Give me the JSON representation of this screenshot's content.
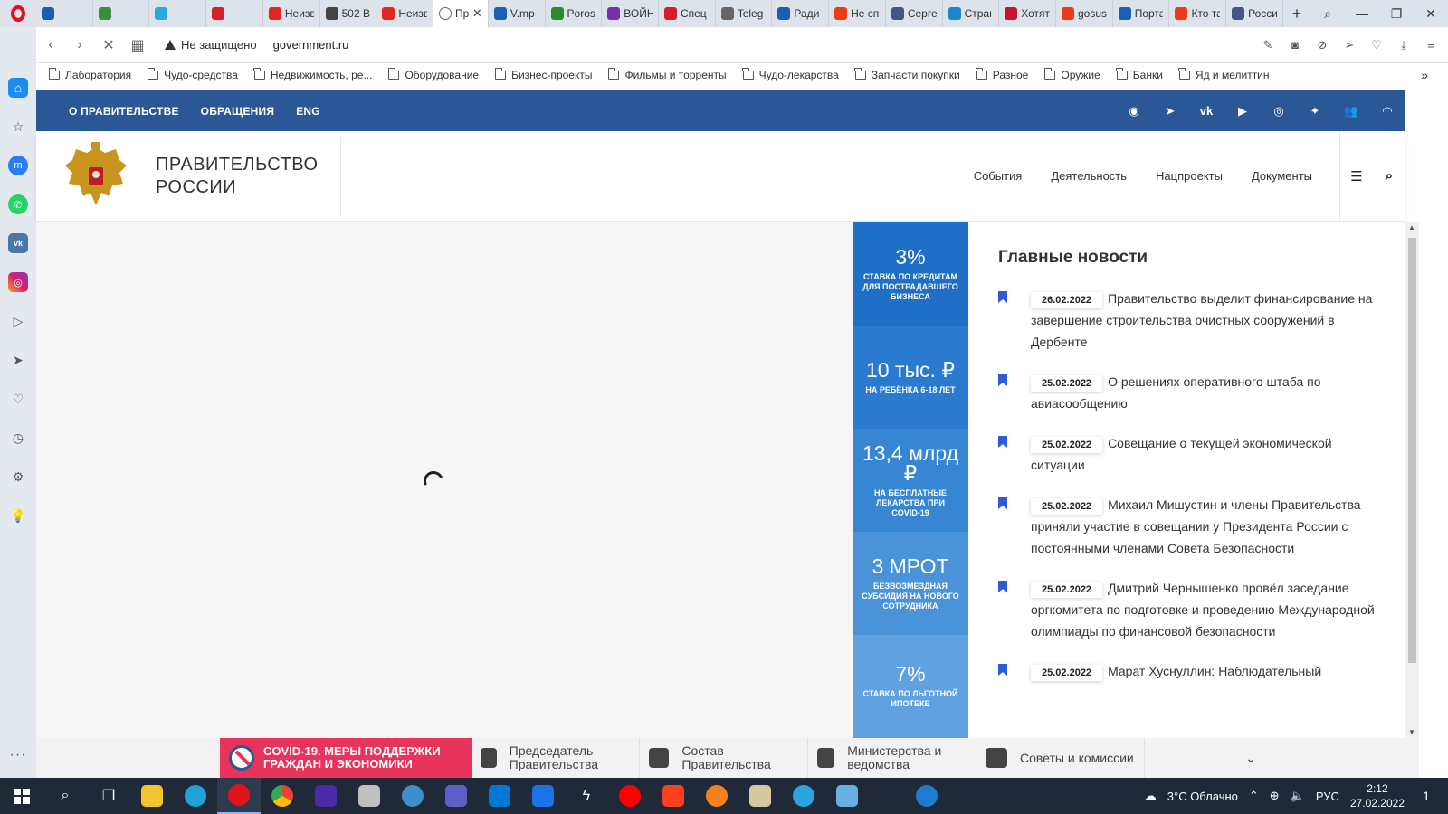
{
  "browser": {
    "tabs": [
      {
        "title": "",
        "color": "#1b5fb5"
      },
      {
        "title": "",
        "color": "#3b8e3b"
      },
      {
        "title": "",
        "color": "#29a9e0"
      },
      {
        "title": "",
        "color": "#d21f2b"
      },
      {
        "title": "Неизв",
        "color": "#e52620"
      },
      {
        "title": "502 B",
        "color": "#444444"
      },
      {
        "title": "Неизв",
        "color": "#e52620"
      },
      {
        "title": "Пр",
        "color": "#ffffff",
        "active": true
      },
      {
        "title": "V.mp",
        "color": "#1b5fb5"
      },
      {
        "title": "Poros",
        "color": "#2c8a2c"
      },
      {
        "title": "ВОЙН",
        "color": "#7a2ea8"
      },
      {
        "title": "Спец",
        "color": "#d21f2b"
      },
      {
        "title": "Teleg",
        "color": "#666666"
      },
      {
        "title": "Ради",
        "color": "#1b5fb5"
      },
      {
        "title": "Не сп",
        "color": "#f03a17"
      },
      {
        "title": "Серге",
        "color": "#445588"
      },
      {
        "title": "Стран",
        "color": "#1a88c9"
      },
      {
        "title": "Хотят",
        "color": "#c4122f"
      },
      {
        "title": "gosus",
        "color": "#f03a17"
      },
      {
        "title": "Порта",
        "color": "#1b5fb5"
      },
      {
        "title": "Кто та",
        "color": "#f03a17"
      },
      {
        "title": "Росси",
        "color": "#445588"
      }
    ],
    "security_label": "Не защищено",
    "url": "government.ru",
    "bookmarks": [
      "Лаборатория",
      "Чудо-средства",
      "Недвижимость, ре...",
      "Оборудование",
      "Бизнес-проекты",
      "Фильмы и торренты",
      "Чудо-лекарства",
      "Запчасти покупки",
      "Разное",
      "Оружие",
      "Банки",
      "Яд и мелиттин"
    ]
  },
  "site": {
    "top_links": [
      "О ПРАВИТЕЛЬСТВЕ",
      "ОБРАЩЕНИЯ",
      "ENG"
    ],
    "title_line1": "ПРАВИТЕЛЬСТВО",
    "title_line2": "РОССИИ",
    "nav": [
      "События",
      "Деятельность",
      "Нацпроекты",
      "Документы"
    ],
    "stats": [
      {
        "big": "3%",
        "small": "СТАВКА ПО КРЕДИТАМ ДЛЯ ПОСТРАДАВШЕГО БИЗНЕСА",
        "color": "#1f6fc6"
      },
      {
        "big": "10 тыс. ₽",
        "small": "НА РЕБЁНКА 6-18 ЛЕТ",
        "color": "#2a7bcf"
      },
      {
        "big": "13,4 млрд ₽",
        "small": "НА БЕСПЛАТНЫЕ ЛЕКАРСТВА ПРИ COVID-19",
        "color": "#3786d4"
      },
      {
        "big": "3 МРОТ",
        "small": "БЕЗВОЗМЕЗДНАЯ СУБСИДИЯ НА НОВОГО СОТРУДНИКА",
        "color": "#4a93d9"
      },
      {
        "big": "7%",
        "small": "СТАВКА ПО ЛЬГОТНОЙ ИПОТЕКЕ",
        "color": "#5fa2df"
      }
    ],
    "news_heading": "Главные новости",
    "news": [
      {
        "date": "26.02.2022",
        "text": "Правительство выделит финансирование на завершение строительства очистных сооружений в Дербенте"
      },
      {
        "date": "25.02.2022",
        "text": "О решениях оперативного штаба по авиасообщению"
      },
      {
        "date": "25.02.2022",
        "text": "Совещание о текущей экономической ситуации"
      },
      {
        "date": "25.02.2022",
        "text": "Михаил Мишустин и члены Правительства приняли участие в совещании у Президента России с постоянными членами Совета Безопасности"
      },
      {
        "date": "25.02.2022",
        "text": "Дмитрий Чернышенко провёл заседание оргкомитета по подготовке и проведению Международной олимпиады по финансовой безопасности"
      },
      {
        "date": "25.02.2022",
        "text": "Марат Хуснуллин: Наблюдательный"
      }
    ],
    "bottom": {
      "covid": "COVID-19. МЕРЫ ПОДДЕРЖКИ ГРАЖДАН И ЭКОНОМИКИ",
      "items": [
        "Председатель Правительства",
        "Состав Правительства",
        "Министерства и ведомства",
        "Советы и комиссии"
      ]
    }
  },
  "taskbar": {
    "weather": "3°C  Облачно",
    "lang": "РУС",
    "time": "2:12",
    "date": "27.02.2022",
    "notifications": "1"
  }
}
